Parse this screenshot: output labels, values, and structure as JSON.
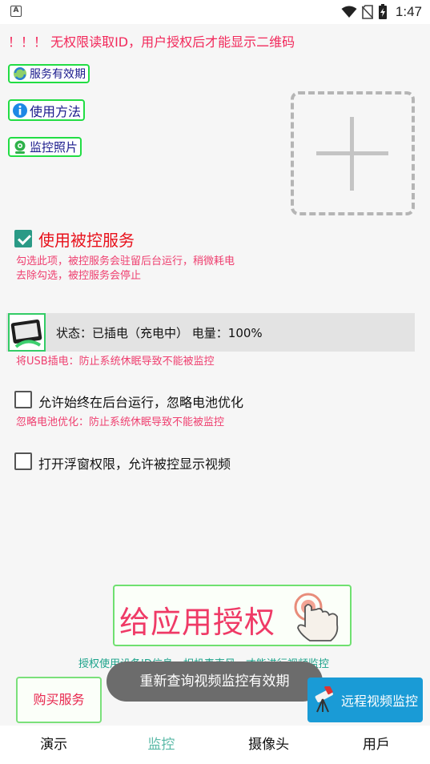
{
  "status_bar": {
    "notification_icon_letter": "A",
    "time": "1:47",
    "icons": [
      "wifi-icon",
      "no-sim-icon",
      "battery-charging-icon"
    ]
  },
  "warning": "！！！ 无权限读取ID，用户授权后才能显示二维码",
  "side_buttons": {
    "validity": "服务有效期",
    "usage": "使用方法",
    "photos": "监控照片"
  },
  "qr_placeholder": {
    "icon": "plus-icon"
  },
  "controlled_service": {
    "label": "使用被控服务",
    "checked": true,
    "note_line1": "勾选此项，被控服务会驻留后台运行，稍微耗电",
    "note_line2": "去除勾选，被控服务会停止"
  },
  "battery": {
    "status_text": "状态：已插电（充电中） 电量：100%",
    "note": "将USB插电：防止系统休眠导致不能被监控"
  },
  "background_option": {
    "label": "允许始终在后台运行，忽略电池优化",
    "checked": false,
    "note": "忽略电池优化：防止系统休眠导致不能被监控"
  },
  "overlay_option": {
    "label": "打开浮窗权限，允许被控显示视频",
    "checked": false
  },
  "auth_button": {
    "label": "给应用授权"
  },
  "auth_note": "授权使用设备ID信息、相机麦克风，才能进行视频监控",
  "buy_button": "购买服务",
  "toast": "重新查询视频监控有效期",
  "remote_button": "远程视频监控",
  "bottom_nav": {
    "tabs": [
      "演示",
      "监控",
      "摄像头",
      "用戶"
    ],
    "active_index": 1
  },
  "colors": {
    "accent_green": "#22dd44",
    "warning_red": "#f2295b",
    "teal": "#2a9a86",
    "remote_blue": "#1a9bd6"
  }
}
